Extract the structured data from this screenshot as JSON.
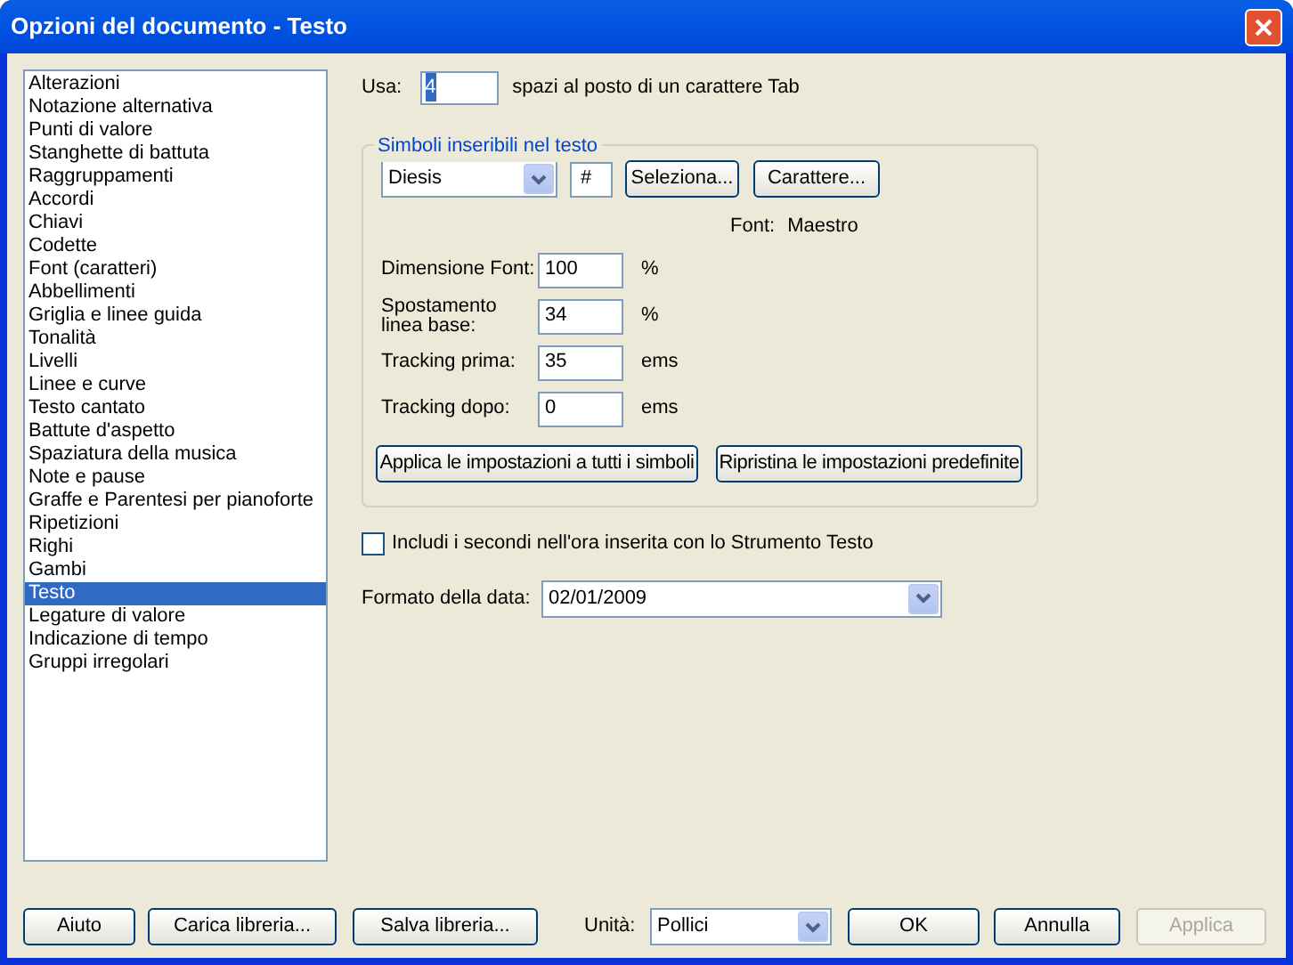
{
  "window": {
    "title": "Opzioni del documento - Testo"
  },
  "sidebar": {
    "items": [
      {
        "label": "Alterazioni",
        "selected": false
      },
      {
        "label": "Notazione alternativa",
        "selected": false
      },
      {
        "label": "Punti di valore",
        "selected": false
      },
      {
        "label": "Stanghette di battuta",
        "selected": false
      },
      {
        "label": "Raggruppamenti",
        "selected": false
      },
      {
        "label": "Accordi",
        "selected": false
      },
      {
        "label": "Chiavi",
        "selected": false
      },
      {
        "label": "Codette",
        "selected": false
      },
      {
        "label": "Font (caratteri)",
        "selected": false
      },
      {
        "label": "Abbellimenti",
        "selected": false
      },
      {
        "label": "Griglia e linee guida",
        "selected": false
      },
      {
        "label": "Tonalità",
        "selected": false
      },
      {
        "label": "Livelli",
        "selected": false
      },
      {
        "label": "Linee e curve",
        "selected": false
      },
      {
        "label": "Testo cantato",
        "selected": false
      },
      {
        "label": "Battute d'aspetto",
        "selected": false
      },
      {
        "label": "Spaziatura della musica",
        "selected": false
      },
      {
        "label": "Note e pause",
        "selected": false
      },
      {
        "label": "Graffe e Parentesi per pianoforte",
        "selected": false
      },
      {
        "label": "Ripetizioni",
        "selected": false
      },
      {
        "label": "Righi",
        "selected": false
      },
      {
        "label": "Gambi",
        "selected": false
      },
      {
        "label": "Testo",
        "selected": true
      },
      {
        "label": "Legature di valore",
        "selected": false
      },
      {
        "label": "Indicazione di tempo",
        "selected": false
      },
      {
        "label": "Gruppi irregolari",
        "selected": false
      }
    ]
  },
  "tab_spaces": {
    "label": "Usa:",
    "value": "4",
    "highlighted": true,
    "suffix": "spazi al posto di un carattere Tab"
  },
  "symbols_group": {
    "title": "Simboli inseribili nel testo",
    "symbol": "Diesis",
    "character": "#",
    "buttons": [
      "Seleziona...",
      "Carattere..."
    ],
    "font_label": "Font:",
    "font_value": "Maestro",
    "fields": [
      {
        "label": "Dimensione Font:",
        "value": "100",
        "unit": "%"
      },
      {
        "label": "Spostamento linea base:",
        "value": "34",
        "unit": "%"
      },
      {
        "label": "Tracking prima:",
        "value": "35",
        "unit": "ems"
      },
      {
        "label": "Tracking dopo:",
        "value": "0",
        "unit": "ems"
      }
    ],
    "actions": [
      "Applica le impostazioni a tutti i simboli",
      "Ripristina le impostazioni predefinite"
    ]
  },
  "include_seconds": {
    "label": "Includi i secondi nell'ora inserita con lo Strumento Testo",
    "checked": false
  },
  "date_format": {
    "label": "Formato della data:",
    "value": "02/01/2009"
  },
  "footer": {
    "left_buttons": [
      {
        "label": "Aiuto",
        "disabled": false
      },
      {
        "label": "Carica libreria...",
        "disabled": false
      },
      {
        "label": "Salva libreria...",
        "disabled": false
      }
    ],
    "units": {
      "label": "Unità:",
      "value": "Pollici"
    },
    "right_buttons": [
      {
        "label": "OK",
        "disabled": false
      },
      {
        "label": "Annulla",
        "disabled": false
      },
      {
        "label": "Applica",
        "disabled": true
      }
    ]
  }
}
